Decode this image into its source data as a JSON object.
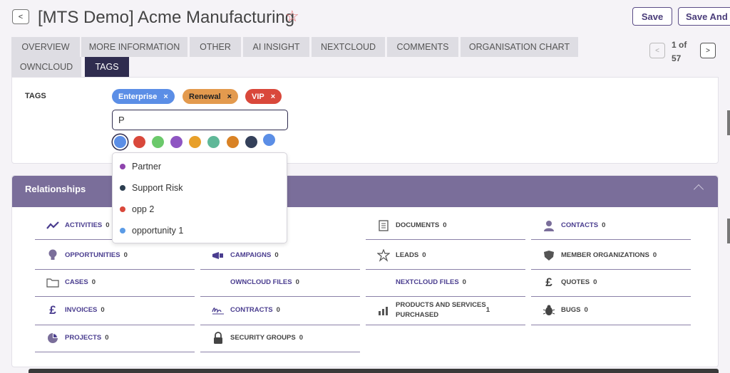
{
  "header": {
    "back_label": "<",
    "title": "[MTS Demo] Acme Manufacturing",
    "star_icon": "star-outline-icon",
    "save_label": "Save",
    "save_and_label": "Save And"
  },
  "tabs": [
    {
      "label": "OVERVIEW",
      "active": false
    },
    {
      "label": "MORE INFORMATION",
      "active": false
    },
    {
      "label": "OTHER",
      "active": false
    },
    {
      "label": "AI INSIGHT",
      "active": false
    },
    {
      "label": "NEXTCLOUD",
      "active": false
    },
    {
      "label": "COMMENTS",
      "active": false
    },
    {
      "label": "ORGANISATION CHART",
      "active": false
    },
    {
      "label": "OWNCLOUD",
      "active": false
    },
    {
      "label": "TAGS",
      "active": true
    }
  ],
  "pager": {
    "prev": "<",
    "text_line1": "1 of",
    "text_line2": "57",
    "next": ">"
  },
  "tags_section": {
    "label": "TAGS",
    "tags": [
      {
        "label": "Enterprise",
        "remove": "×",
        "color": "#5b8ee6"
      },
      {
        "label": "Renewal",
        "remove": "×",
        "color": "#e39a4e"
      },
      {
        "label": "VIP",
        "remove": "×",
        "color": "#d9483b"
      }
    ],
    "input_value": "P",
    "swatches": [
      "#5b8ee6",
      "#d9483b",
      "#6bc96b",
      "#8e55c2",
      "#e8a02a",
      "#5fb898",
      "#d98225",
      "#34405a",
      "#5b8ee6"
    ]
  },
  "dropdown": {
    "items": [
      {
        "label": "Partner",
        "color": "#8e44ad"
      },
      {
        "label": "Support Risk",
        "color": "#2c3e50"
      },
      {
        "label": "opp 2",
        "color": "#d9483b"
      },
      {
        "label": "opportunity 1",
        "color": "#5b9be6"
      }
    ]
  },
  "relationships": {
    "title": "Relationships",
    "items": [
      {
        "label": "ACTIVITIES",
        "count": "0",
        "icon": "activity-icon"
      },
      {
        "label": "DOCUMENTS",
        "count": "0",
        "icon": "documents-icon"
      },
      {
        "label": "CONTACTS",
        "count": "0",
        "icon": "contact-person-icon"
      },
      {
        "label": "OPPORTUNITIES",
        "count": "0",
        "icon": "lightbulb-icon"
      },
      {
        "label": "CAMPAIGNS",
        "count": "0",
        "icon": "megaphone-icon"
      },
      {
        "label": "LEADS",
        "count": "0",
        "icon": "leads-star-icon"
      },
      {
        "label": "MEMBER ORGANIZATIONS",
        "count": "0",
        "icon": "shield-icon"
      },
      {
        "label": "CASES",
        "count": "0",
        "icon": "folder-icon"
      },
      {
        "label": "OWNCLOUD FILES",
        "count": "0",
        "icon": ""
      },
      {
        "label": "NEXTCLOUD FILES",
        "count": "0",
        "icon": ""
      },
      {
        "label": "QUOTES",
        "count": "0",
        "icon": "pound-icon"
      },
      {
        "label": "INVOICES",
        "count": "0",
        "icon": "pound-icon"
      },
      {
        "label": "CONTRACTS",
        "count": "0",
        "icon": "signature-icon"
      },
      {
        "label": "PRODUCTS AND SERVICES",
        "label2": "PURCHASED",
        "count": "1",
        "icon": "bar-chart-icon"
      },
      {
        "label": "BUGS",
        "count": "0",
        "icon": "bug-icon"
      },
      {
        "label": "PROJECTS",
        "count": "0",
        "icon": "pie-chart-icon"
      },
      {
        "label": "SECURITY GROUPS",
        "count": "0",
        "icon": "lock-icon"
      }
    ]
  }
}
